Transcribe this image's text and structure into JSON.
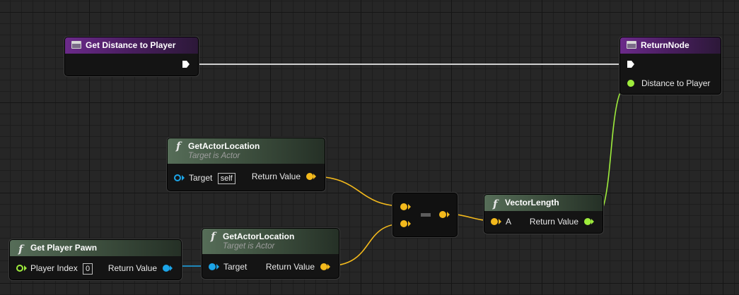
{
  "nodes": {
    "entry": {
      "title": "Get Distance to Player"
    },
    "return_node": {
      "title": "ReturnNode",
      "output_pin": "Distance to Player"
    },
    "get_actor_location_1": {
      "title": "GetActorLocation",
      "subtitle": "Target is Actor",
      "target_label": "Target",
      "target_default": "self",
      "return_label": "Return Value"
    },
    "get_actor_location_2": {
      "title": "GetActorLocation",
      "subtitle": "Target is Actor",
      "target_label": "Target",
      "return_label": "Return Value"
    },
    "get_player_pawn": {
      "title": "Get Player Pawn",
      "index_label": "Player Index",
      "index_default": "0",
      "return_label": "Return Value"
    },
    "subtract": {
      "operator": "-"
    },
    "vector_length": {
      "title": "VectorLength",
      "input_label": "A",
      "return_label": "Return Value"
    }
  },
  "icons": {
    "function": "f",
    "event": "event-icon"
  },
  "colors": {
    "vector_pin": "#f3b91c",
    "float_pin": "#9eec3c",
    "object_pin": "#1ca5e8",
    "exec_wire": "#cfcfcf",
    "entry_header": "#6b2a8a",
    "function_header": "#566d58"
  }
}
